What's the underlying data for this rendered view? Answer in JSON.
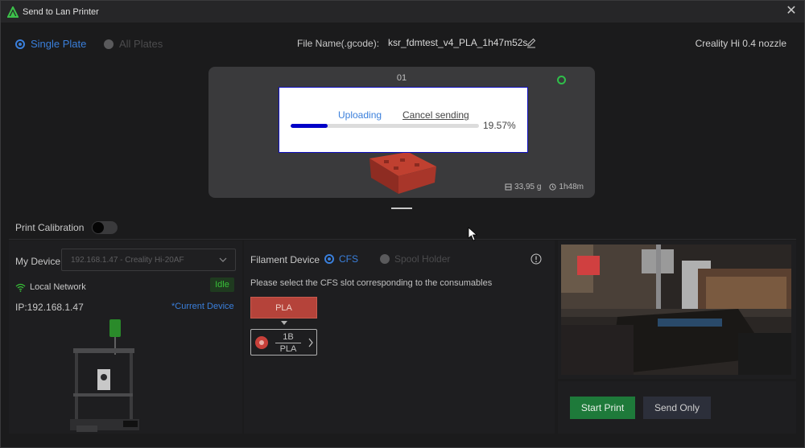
{
  "window": {
    "title": "Send to Lan Printer"
  },
  "plates": {
    "single_label": "Single Plate",
    "all_label": "All Plates",
    "selected": "single"
  },
  "file": {
    "label": "File Name(.gcode):",
    "name": "ksr_fdmtest_v4_PLA_1h47m52s"
  },
  "printer_profile": "Creality Hi 0.4 nozzle",
  "plate": {
    "number": "01",
    "weight": "33,95 g",
    "time": "1h48m"
  },
  "upload": {
    "status": "Uploading",
    "cancel_label": "Cancel sending",
    "progress_text": "19.57%",
    "progress_fraction": 0.1957
  },
  "calibration": {
    "label": "Print Calibration",
    "enabled": false
  },
  "device": {
    "label": "My Device",
    "selected": "192.168.1.47 - Creality Hi-20AF",
    "network": "Local Network",
    "status": "Idle",
    "ip": "IP:192.168.1.47",
    "current_label": "*Current Device"
  },
  "filament": {
    "label": "Filament Device",
    "cfs_label": "CFS",
    "spool_label": "Spool Holder",
    "hint": "Please select the CFS slot corresponding to the consumables",
    "material_label": "PLA",
    "slot_id": "1B",
    "slot_material": "PLA"
  },
  "actions": {
    "start_label": "Start Print",
    "send_only_label": "Send Only"
  },
  "colors": {
    "accent": "#3a7fdb",
    "start": "#1e7a3a",
    "material": "#b5433a",
    "idle": "#38c038"
  }
}
